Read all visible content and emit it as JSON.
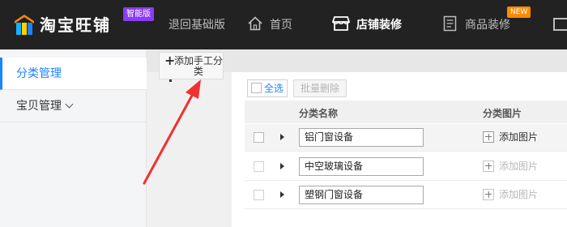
{
  "header": {
    "brand": "淘宝旺铺",
    "edition_badge": "智能版",
    "nav": {
      "back_basic": "退回基础版",
      "home": "首页",
      "store_decor": "店铺装修",
      "product_decor": "商品装修",
      "new_badge": "NEW"
    }
  },
  "sidebar": {
    "items": [
      {
        "label": "分类管理",
        "active": true
      },
      {
        "label": "宝贝管理",
        "active": false
      }
    ]
  },
  "toolbar": {
    "add_manual_category": "添加手工分类",
    "select_all": "全选",
    "batch_delete": "批量删除"
  },
  "table": {
    "columns": [
      "分类名称",
      "分类图片"
    ],
    "rows": [
      {
        "name": "铝门窗设备",
        "add_image": "添加图片",
        "highlighted": true,
        "image_link_enabled": true
      },
      {
        "name": "中空玻璃设备",
        "add_image": "添加图片",
        "highlighted": false,
        "image_link_enabled": false
      },
      {
        "name": "塑钢门窗设备",
        "add_image": "添加图片",
        "highlighted": false,
        "image_link_enabled": false
      }
    ]
  },
  "colors": {
    "topbar": "#222222",
    "accent_blue": "#1a85ff",
    "badge_purple": "#8b3cf0",
    "badge_orange": "#ff8a00",
    "annotation_red": "#f23030"
  },
  "icons": {
    "logo": "shop-logo-icon",
    "home": "home-icon",
    "store": "store-icon",
    "product": "document-icon"
  }
}
